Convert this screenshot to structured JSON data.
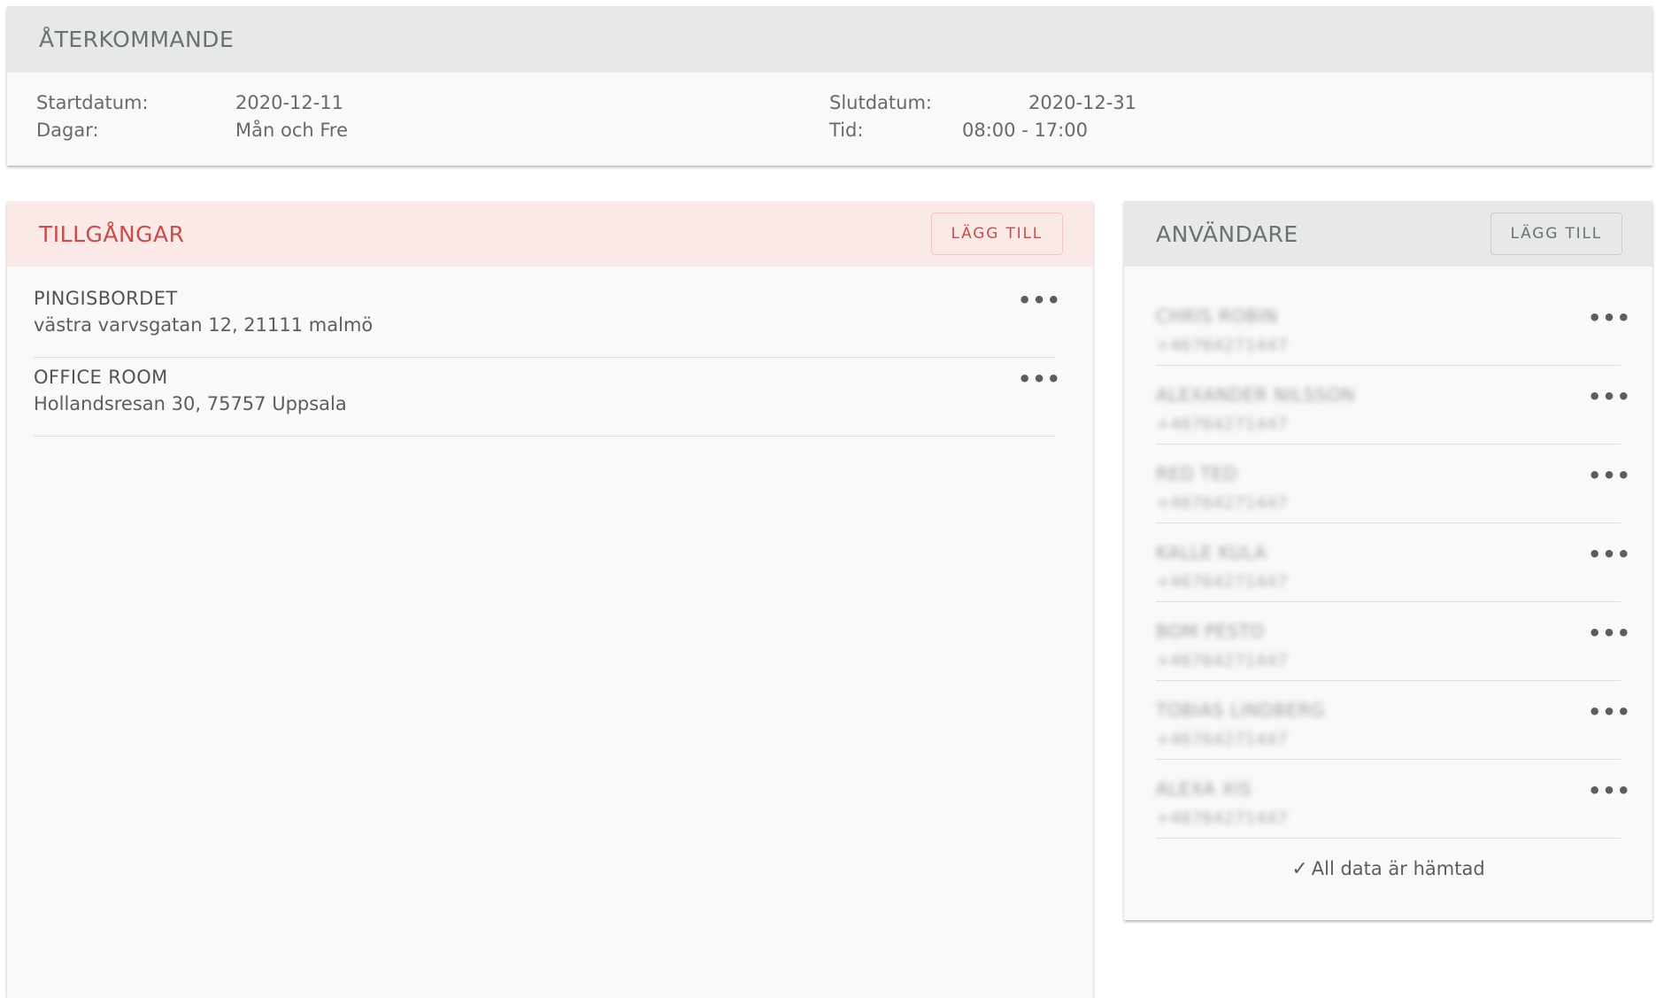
{
  "recurring": {
    "title": "ÅTERKOMMANDE",
    "start_label": "Startdatum:",
    "start_value": "2020-12-11",
    "days_label": "Dagar:",
    "days_value": "Mån och Fre",
    "end_label": "Slutdatum:",
    "end_value": "2020-12-31",
    "time_label": "Tid:",
    "time_value": "08:00 - 17:00"
  },
  "assets": {
    "title": "TILLGÅNGAR",
    "add_label": "LÄGG TILL",
    "items": [
      {
        "name": "PINGISBORDET",
        "address": "västra varvsgatan 12, 21111 malmö"
      },
      {
        "name": "OFFICE ROOM",
        "address": "Hollandsresan 30, 75757 Uppsala"
      }
    ]
  },
  "users": {
    "title": "ANVÄNDARE",
    "add_label": "LÄGG TILL",
    "items": [
      {
        "name": "CHRIS ROBIN",
        "phone": "+46764271447"
      },
      {
        "name": "ALEXANDER NILSSON",
        "phone": "+46764271447"
      },
      {
        "name": "RED TED",
        "phone": "+46764271447"
      },
      {
        "name": "KALLE KULA",
        "phone": "+46764271447"
      },
      {
        "name": "BOM PESTO",
        "phone": "+46764271447"
      },
      {
        "name": "TOBIAS LINDBERG",
        "phone": "+46764271447"
      },
      {
        "name": "ALEXA XIS",
        "phone": "+46764271447"
      }
    ],
    "footer": "All data är hämtad",
    "more_glyph": "•••"
  },
  "colors": {
    "accent": "#c84d4a",
    "header_gray": "#e6e9e8",
    "header_pink": "#fbe9e8",
    "card_bg": "#f9f9f9"
  },
  "icons": {
    "more": "more-horizontal-icon",
    "check": "check-icon"
  }
}
